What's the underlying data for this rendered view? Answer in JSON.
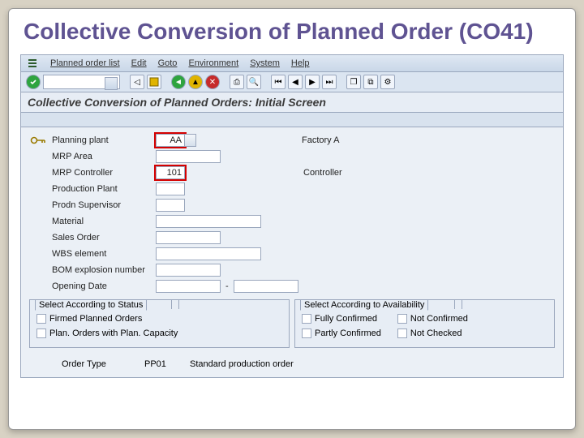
{
  "slide": {
    "title": "Collective Conversion of Planned Order (CO41)"
  },
  "menu": {
    "m1": "Planned order list",
    "m2": "Edit",
    "m3": "Goto",
    "m4": "Environment",
    "m5": "System",
    "m6": "Help"
  },
  "screen": {
    "title": "Collective Conversion of Planned Orders: Initial Screen"
  },
  "form": {
    "planning_plant": {
      "label": "Planning plant",
      "value": "AA",
      "desc": "Factory A"
    },
    "mrp_area": {
      "label": "MRP Area",
      "value": ""
    },
    "mrp_controller": {
      "label": "MRP Controller",
      "value": "101",
      "desc": "Controller"
    },
    "production_plant": {
      "label": "Production Plant",
      "value": ""
    },
    "prodn_supervisor": {
      "label": "Prodn Supervisor",
      "value": ""
    },
    "material": {
      "label": "Material",
      "value": ""
    },
    "sales_order": {
      "label": "Sales Order",
      "value": ""
    },
    "wbs_element": {
      "label": "WBS element",
      "value": ""
    },
    "bom_expl_num": {
      "label": "BOM explosion number",
      "value": ""
    },
    "opening_date": {
      "label": "Opening Date",
      "value": "",
      "sep": "-"
    }
  },
  "group_status": {
    "title": "Select According to Status",
    "firmed": "Firmed Planned Orders",
    "capacity": "Plan. Orders with Plan. Capacity"
  },
  "group_avail": {
    "title": "Select According to Availability",
    "fully": "Fully Confirmed",
    "partly": "Partly Confirmed",
    "notconf": "Not Confirmed",
    "notcheck": "Not Checked"
  },
  "order_type": {
    "label": "Order Type",
    "value": "PP01",
    "desc": "Standard production order"
  }
}
